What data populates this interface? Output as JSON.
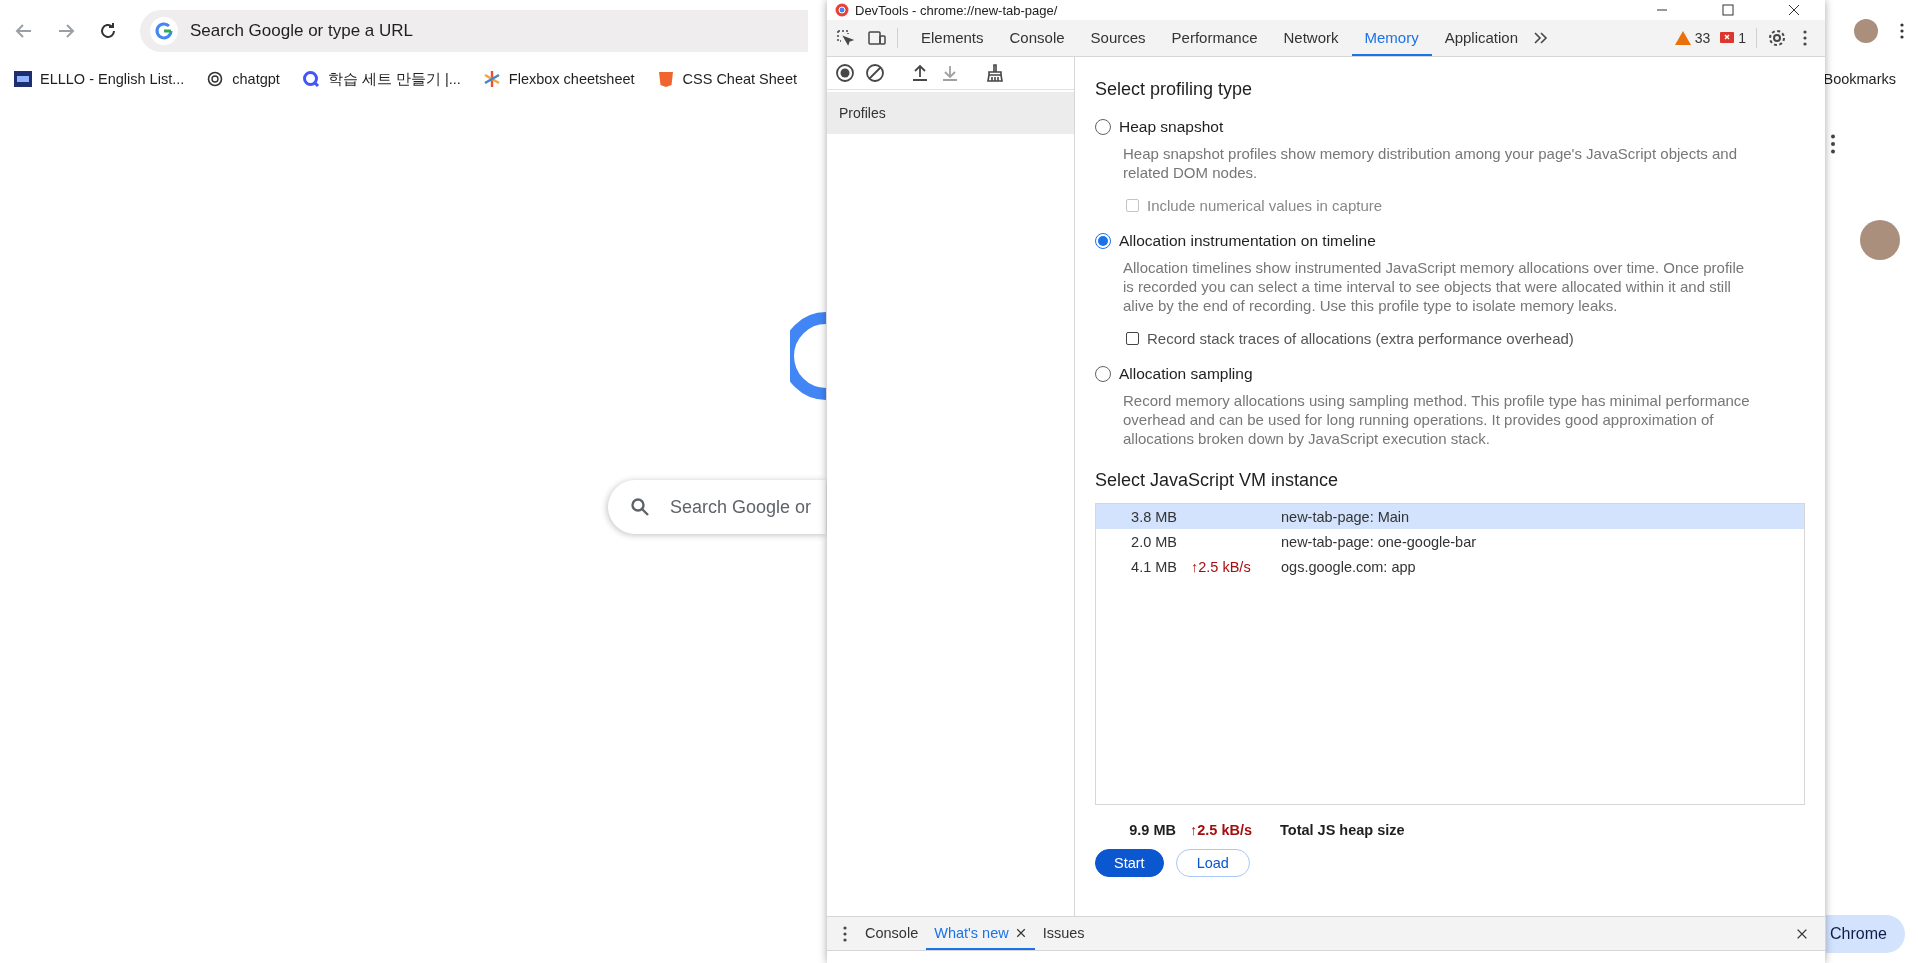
{
  "browser": {
    "address_placeholder": "Search Google or type a URL",
    "bookmarks": [
      {
        "label": "ELLLO - English List...",
        "kind": "ello"
      },
      {
        "label": "chatgpt",
        "kind": "knot"
      },
      {
        "label": "학습 세트 만들기 |...",
        "kind": "quizlet"
      },
      {
        "label": "Flexbox cheetsheet",
        "kind": "asterisk"
      },
      {
        "label": "CSS Cheat Sheet",
        "kind": "shield"
      }
    ],
    "bookmarks_label": "Bookmarks",
    "page_search_placeholder": "Search Google or",
    "customize_button": "Chrome"
  },
  "devtools": {
    "title": "DevTools - chrome://new-tab-page/",
    "tabs": [
      {
        "label": "Elements",
        "selected": false
      },
      {
        "label": "Console",
        "selected": false
      },
      {
        "label": "Sources",
        "selected": false
      },
      {
        "label": "Performance",
        "selected": false
      },
      {
        "label": "Network",
        "selected": false
      },
      {
        "label": "Memory",
        "selected": true
      },
      {
        "label": "Application",
        "selected": false
      }
    ],
    "warnings": "33",
    "errors": "1",
    "sidebar": {
      "items": [
        {
          "label": "Profiles",
          "selected": true
        }
      ]
    },
    "profiling": {
      "title": "Select profiling type",
      "options": [
        {
          "label": "Heap snapshot",
          "selected": false,
          "description": "Heap snapshot profiles show memory distribution among your page's JavaScript objects and related DOM nodes.",
          "checkbox": {
            "label": "Include numerical values in capture",
            "checked": false,
            "disabled": true
          }
        },
        {
          "label": "Allocation instrumentation on timeline",
          "selected": true,
          "description": "Allocation timelines show instrumented JavaScript memory allocations over time. Once profile is recorded you can select a time interval to see objects that were allocated within it and still alive by the end of recording. Use this profile type to isolate memory leaks.",
          "checkbox": {
            "label": "Record stack traces of allocations (extra performance overhead)",
            "checked": false,
            "disabled": false
          }
        },
        {
          "label": "Allocation sampling",
          "selected": false,
          "description": "Record memory allocations using sampling method. This profile type has minimal performance overhead and can be used for long running operations. It provides good approximation of allocations broken down by JavaScript execution stack."
        }
      ]
    },
    "vm": {
      "title": "Select JavaScript VM instance",
      "instances": [
        {
          "size": "3.8 MB",
          "name": "new-tab-page: Main",
          "selected": true
        },
        {
          "size": "2.0 MB",
          "name": "new-tab-page: one-google-bar",
          "selected": false
        },
        {
          "size": "4.1 MB",
          "rate": "↑2.5 kB/s",
          "name": "ogs.google.com: app",
          "selected": false
        }
      ],
      "total": {
        "size": "9.9 MB",
        "rate": "↑2.5 kB/s",
        "label": "Total JS heap size"
      }
    },
    "buttons": [
      {
        "label": "Start",
        "kind": "primary"
      },
      {
        "label": "Load",
        "kind": "secondary"
      }
    ],
    "drawer": {
      "tabs": [
        {
          "label": "Console",
          "selected": false,
          "closable": false
        },
        {
          "label": "What's new",
          "selected": true,
          "closable": true
        },
        {
          "label": "Issues",
          "selected": false,
          "closable": false
        }
      ]
    }
  }
}
